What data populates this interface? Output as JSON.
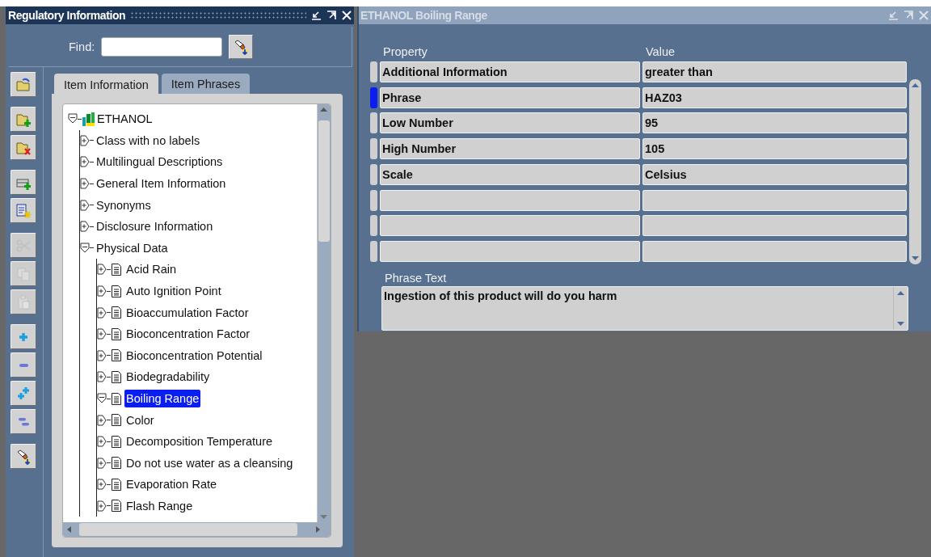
{
  "regulatory_window": {
    "title": "Regulatory Information",
    "active": true,
    "find": {
      "label": "Find:"
    },
    "toolbar": [
      [
        {
          "kind": "open",
          "disabled": false
        }
      ],
      [
        {
          "kind": "new-folder",
          "disabled": false
        },
        {
          "kind": "delete-folder",
          "disabled": false
        }
      ],
      [
        {
          "kind": "add-row",
          "disabled": false
        },
        {
          "kind": "new-record",
          "disabled": false
        }
      ],
      [
        {
          "kind": "cut",
          "disabled": true
        },
        {
          "kind": "copy",
          "disabled": true
        },
        {
          "kind": "paste",
          "disabled": true
        }
      ],
      [
        {
          "kind": "expand",
          "disabled": false
        },
        {
          "kind": "collapse",
          "disabled": false
        },
        {
          "kind": "expand-all",
          "disabled": false
        },
        {
          "kind": "collapse-all",
          "disabled": false
        }
      ],
      [
        {
          "kind": "find",
          "disabled": false
        }
      ]
    ],
    "tabs": [
      {
        "label": "Item Information",
        "selected": true
      },
      {
        "label": "Item Phrases",
        "selected": false
      }
    ],
    "tree": [
      {
        "label": "ETHANOL",
        "kind": "root",
        "expanded": true,
        "selected": false,
        "children": [
          {
            "label": "Class with no labels",
            "kind": "category",
            "expanded": false,
            "selected": false
          },
          {
            "label": "Multilingual Descriptions",
            "kind": "category",
            "expanded": false,
            "selected": false
          },
          {
            "label": "General Item Information",
            "kind": "category",
            "expanded": false,
            "selected": false
          },
          {
            "label": "Synonyms",
            "kind": "category",
            "expanded": false,
            "selected": false
          },
          {
            "label": "Disclosure Information",
            "kind": "category",
            "expanded": false,
            "selected": false
          },
          {
            "label": "Physical Data",
            "kind": "category",
            "expanded": true,
            "selected": false,
            "children": [
              {
                "label": "Acid Rain",
                "kind": "property",
                "expanded": false,
                "selected": false
              },
              {
                "label": "Auto Ignition Point",
                "kind": "property",
                "expanded": false,
                "selected": false
              },
              {
                "label": "Bioaccumulation Factor",
                "kind": "property",
                "expanded": false,
                "selected": false
              },
              {
                "label": "Bioconcentration Factor",
                "kind": "property",
                "expanded": false,
                "selected": false
              },
              {
                "label": "Bioconcentration Potential",
                "kind": "property",
                "expanded": false,
                "selected": false
              },
              {
                "label": "Biodegradability",
                "kind": "property",
                "expanded": false,
                "selected": false
              },
              {
                "label": "Boiling Range",
                "kind": "property",
                "expanded": true,
                "selected": true
              },
              {
                "label": "Color",
                "kind": "property",
                "expanded": false,
                "selected": false
              },
              {
                "label": "Decomposition Temperature",
                "kind": "property",
                "expanded": false,
                "selected": false
              },
              {
                "label": "Do not use water as a cleansing",
                "kind": "property",
                "expanded": false,
                "selected": false
              },
              {
                "label": "Evaporation Rate",
                "kind": "property",
                "expanded": false,
                "selected": false
              },
              {
                "label": "Flash Range",
                "kind": "property",
                "expanded": false,
                "selected": false
              }
            ]
          }
        ]
      }
    ]
  },
  "detail_window": {
    "title": "ETHANOL Boiling Range",
    "active": false,
    "columns": [
      "Property",
      "Value"
    ],
    "rows": [
      {
        "property": "Additional Information",
        "value": "greater than",
        "selected": false
      },
      {
        "property": "Phrase",
        "value": "HAZ03",
        "selected": true
      },
      {
        "property": "Low Number",
        "value": "95",
        "selected": false
      },
      {
        "property": "High Number",
        "value": "105",
        "selected": false
      },
      {
        "property": "Scale",
        "value": "Celsius",
        "selected": false
      },
      {
        "selected": false
      },
      {
        "selected": false
      },
      {
        "selected": false
      }
    ],
    "phrase_text": {
      "label": "Phrase Text",
      "value": "Ingestion of this product will do you harm"
    }
  }
}
